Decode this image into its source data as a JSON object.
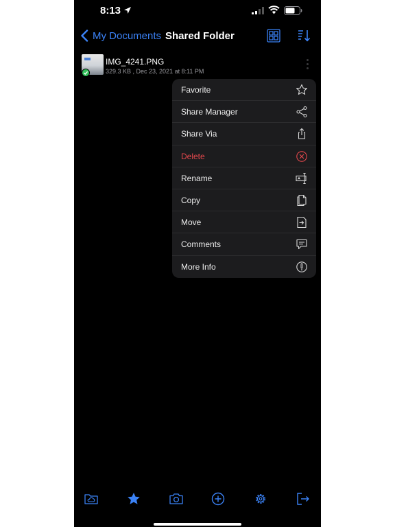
{
  "status_bar": {
    "time": "8:13",
    "icons": [
      "location-arrow-icon",
      "cellular-signal-icon",
      "wifi-icon",
      "battery-icon"
    ]
  },
  "nav": {
    "back_label": "My Documents",
    "title": "Shared Folder",
    "actions": [
      "grid-view-icon",
      "sort-icon"
    ]
  },
  "file": {
    "name": "IMG_4241.PNG",
    "meta": "329.3 KB , Dec 23, 2021 at 8:11 PM",
    "synced": true
  },
  "menu": {
    "items": [
      {
        "label": "Favorite",
        "icon": "star-icon"
      },
      {
        "label": "Share Manager",
        "icon": "share-nodes-icon"
      },
      {
        "label": "Share Via",
        "icon": "share-upload-icon"
      },
      {
        "label": "Delete",
        "icon": "delete-circle-x-icon",
        "destructive": true
      },
      {
        "label": "Rename",
        "icon": "rename-icon"
      },
      {
        "label": "Copy",
        "icon": "copy-icon"
      },
      {
        "label": "Move",
        "icon": "move-icon"
      },
      {
        "label": "Comments",
        "icon": "comments-icon"
      },
      {
        "label": "More Info",
        "icon": "info-icon"
      }
    ]
  },
  "tab_bar": {
    "items": [
      "cloud-folder-icon",
      "favorites-star-icon",
      "camera-icon",
      "add-circle-icon",
      "settings-gear-icon",
      "logout-icon"
    ]
  },
  "colors": {
    "accent": "#3b82f6",
    "destructive": "#e5484d",
    "background": "#000000",
    "menu_background": "#1c1c1e",
    "secondary_text": "#9a9a9f"
  }
}
